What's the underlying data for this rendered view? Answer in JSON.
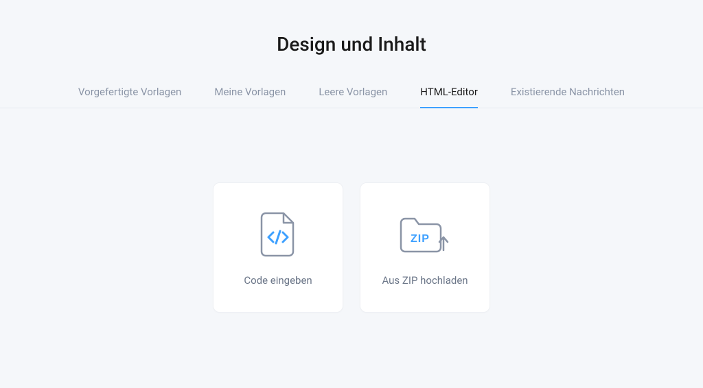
{
  "title": "Design und Inhalt",
  "tabs": [
    {
      "label": "Vorgefertigte Vorlagen",
      "active": false
    },
    {
      "label": "Meine Vorlagen",
      "active": false
    },
    {
      "label": "Leere Vorlagen",
      "active": false
    },
    {
      "label": "HTML-Editor",
      "active": true
    },
    {
      "label": "Existierende Nachrichten",
      "active": false
    }
  ],
  "cards": {
    "enter_code": {
      "label": "Code eingeben"
    },
    "upload_zip": {
      "label": "Aus ZIP hochladen",
      "zip_label": "ZIP"
    }
  },
  "colors": {
    "accent": "#3da0ff",
    "icon_stroke": "#8a94a6",
    "text_muted": "#8a94a6"
  }
}
